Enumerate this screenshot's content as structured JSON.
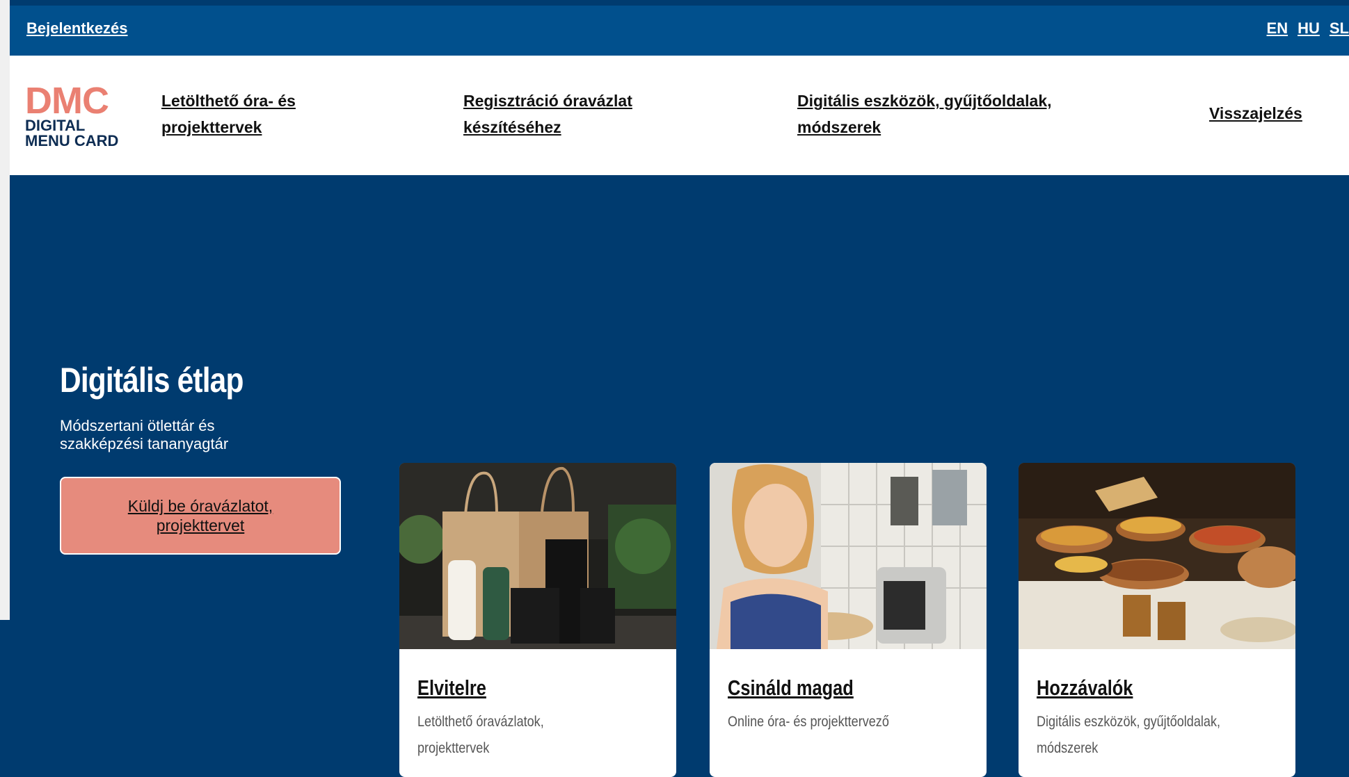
{
  "topbar": {
    "login": "Bejelentkezés",
    "languages": [
      "EN",
      "HU",
      "SL"
    ]
  },
  "logo": {
    "mark": "DMC",
    "line1": "DIGITAL",
    "line2": "MENU CARD"
  },
  "nav": {
    "item1": "Letölthető óra- és projekttervek",
    "item2": "Regisztráció óravázlat készítéséhez",
    "item3": "Digitális eszközök, gyűjtőoldalak, módszerek",
    "item4": "Visszajelzés"
  },
  "hero": {
    "title": "Digitális étlap",
    "subtitle": "Módszertani ötlettár és szakképzési tananyagtár",
    "cta": "Küldj be óravázlatot, projekttervet"
  },
  "cards": [
    {
      "title": "Elvitelre",
      "desc1": "Letölthető óravázlatok,",
      "desc2": "projekttervek"
    },
    {
      "title": "Csináld magad",
      "desc1": "Online óra- és projekttervező",
      "desc2": ""
    },
    {
      "title": "Hozzávalók",
      "desc1": "Digitális eszközök, gyűjtőoldalak,",
      "desc2": "módszerek"
    }
  ],
  "colors": {
    "topbar": "#01508d",
    "hero_bg": "#003b6f",
    "cta_bg": "#e68b7d",
    "logo_accent": "#ea8072",
    "logo_dark": "#0e2d53"
  }
}
